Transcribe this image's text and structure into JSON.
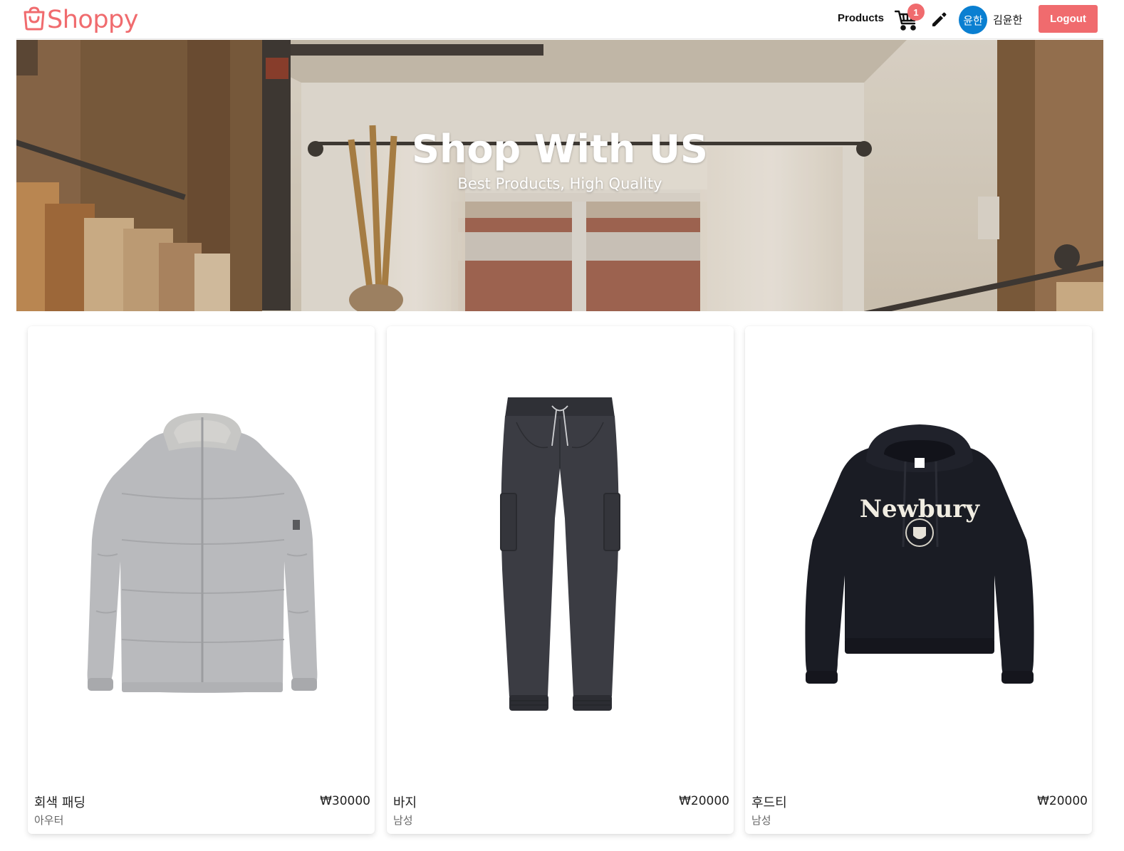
{
  "header": {
    "logo_text": "Shoppy",
    "nav_products": "Products",
    "cart_count": "1",
    "avatar_text": "윤한",
    "username": "김윤한",
    "logout_label": "Logout"
  },
  "banner": {
    "title": "Shop With US",
    "subtitle": "Best Products, High Quality"
  },
  "products": [
    {
      "name": "회색 패딩",
      "price": "₩30000",
      "category": "아우터",
      "image": "gray-puffer-jacket"
    },
    {
      "name": "바지",
      "price": "₩20000",
      "category": "남성",
      "image": "dark-cargo-pants"
    },
    {
      "name": "후드티",
      "price": "₩20000",
      "category": "남성",
      "image": "black-newbury-hoodie",
      "print_text": "Newbury"
    }
  ],
  "colors": {
    "accent": "#f06b6e",
    "avatar": "#0a7fd1"
  }
}
